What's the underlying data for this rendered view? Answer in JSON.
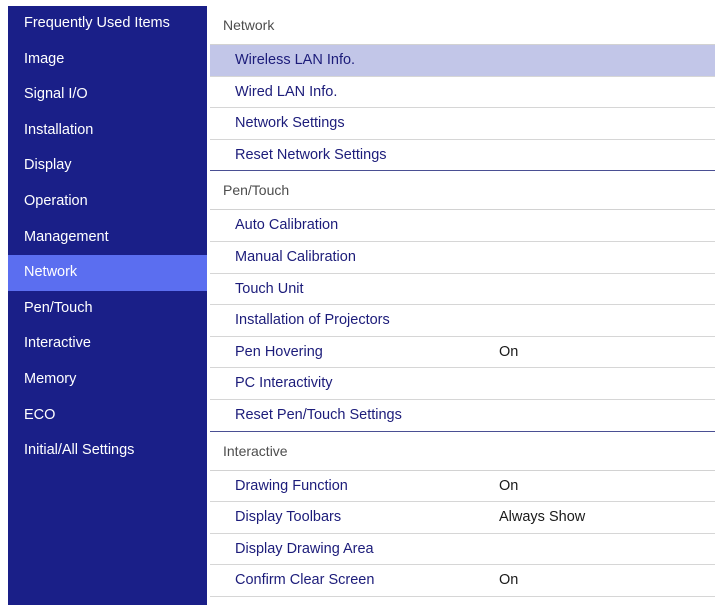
{
  "sidebar": {
    "items": [
      {
        "label": "Frequently Used Items"
      },
      {
        "label": "Image"
      },
      {
        "label": "Signal I/O"
      },
      {
        "label": "Installation"
      },
      {
        "label": "Display"
      },
      {
        "label": "Operation"
      },
      {
        "label": "Management"
      },
      {
        "label": "Network",
        "selected": true
      },
      {
        "label": "Pen/Touch"
      },
      {
        "label": "Interactive"
      },
      {
        "label": "Memory"
      },
      {
        "label": "ECO"
      },
      {
        "label": "Initial/All Settings"
      }
    ]
  },
  "main": {
    "sections": [
      {
        "title": "Network",
        "items": [
          {
            "label": "Wireless LAN Info.",
            "value": "",
            "selected": true
          },
          {
            "label": "Wired LAN Info.",
            "value": ""
          },
          {
            "label": "Network Settings",
            "value": ""
          },
          {
            "label": "Reset Network Settings",
            "value": ""
          }
        ]
      },
      {
        "title": "Pen/Touch",
        "items": [
          {
            "label": "Auto Calibration",
            "value": ""
          },
          {
            "label": "Manual Calibration",
            "value": ""
          },
          {
            "label": "Touch Unit",
            "value": ""
          },
          {
            "label": "Installation of Projectors",
            "value": ""
          },
          {
            "label": "Pen Hovering",
            "value": "On"
          },
          {
            "label": "PC Interactivity",
            "value": ""
          },
          {
            "label": "Reset Pen/Touch Settings",
            "value": ""
          }
        ]
      },
      {
        "title": "Interactive",
        "items": [
          {
            "label": "Drawing Function",
            "value": "On"
          },
          {
            "label": "Display Toolbars",
            "value": "Always Show"
          },
          {
            "label": "Display Drawing Area",
            "value": ""
          },
          {
            "label": "Confirm Clear Screen",
            "value": "On"
          }
        ]
      }
    ]
  },
  "colors": {
    "sidebar_bg": "#1a1f88",
    "sidebar_selected": "#5b6ef0",
    "row_selected": "#c2c6e8",
    "menu_text": "#1c1c7a"
  }
}
